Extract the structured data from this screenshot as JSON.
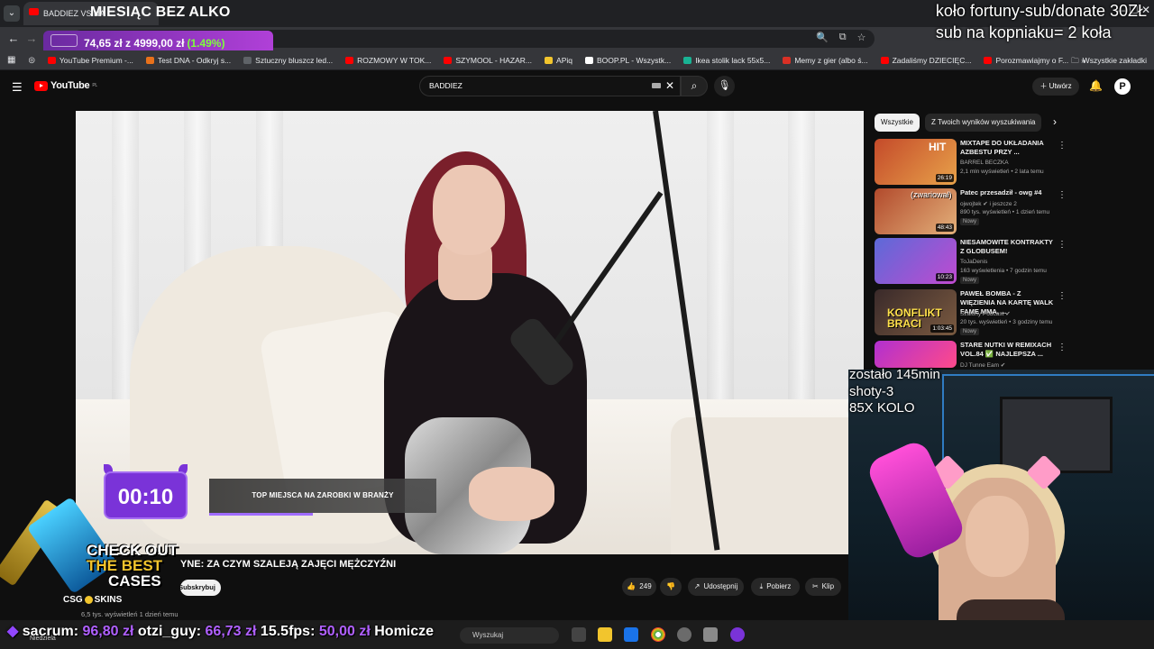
{
  "browser": {
    "tab_title": "BADDIEZ VS NA",
    "tab_title_suffix": "...",
    "dropdown_glyph": "⌄",
    "window_controls": "—   ☐   ✕",
    "toolbar_icons": [
      "🔍",
      "⧉",
      "☆",
      "⋮"
    ]
  },
  "stream_overlay": {
    "title": "MIESIĄC BEZ ALKO",
    "donation_current": "74,65 zł",
    "donation_sep": "z",
    "donation_goal": "4999,00 zł",
    "donation_pct": "(1.49%)",
    "donation_progress": 0.0149,
    "top_right_line1": "koło fortuny-sub/donate 30ZŁ",
    "top_right_line2": "sub na kopniaku= 2 koła",
    "cam_line1": "zostało 145min",
    "cam_line2": "shoty-3",
    "cam_line3": "85X KOLO",
    "timer": "00:10",
    "ticker_segments": [
      {
        "name": "sacrum:",
        "amount": "96,80 zł"
      },
      {
        "name": "otzi_guy:",
        "amount": "66,73 zł"
      },
      {
        "name": "15.5fps:",
        "amount": "50,00 zł"
      },
      {
        "name": "Homicze",
        "amount": ""
      }
    ]
  },
  "bookmarks": {
    "items": [
      {
        "label": "YouTube Premium -...",
        "color": "#ff0000"
      },
      {
        "label": "Test DNA - Odkryj s...",
        "color": "#e8711b"
      },
      {
        "label": "Sztuczny bluszcz led...",
        "color": "#5f6368"
      },
      {
        "label": "ROZMOWY W TOK...",
        "color": "#ff0000"
      },
      {
        "label": "SZYMOOL - HAZAR...",
        "color": "#ff0000"
      },
      {
        "label": "APiq",
        "color": "#f2c52d"
      },
      {
        "label": "BOOP.PL - Wszystk...",
        "color": "#ffffff"
      },
      {
        "label": "Ikea stolik lack 55x5...",
        "color": "#19b394"
      },
      {
        "label": "Memy z gier (albo ś...",
        "color": "#d93025"
      },
      {
        "label": "Zadaliśmy DZIECIĘC...",
        "color": "#ff0000"
      },
      {
        "label": "Porozmawiajmy o F...",
        "color": "#ff0000"
      }
    ],
    "overflow": "»",
    "all_label": "Wszystkie zakładki"
  },
  "youtube": {
    "logo": "YouTube",
    "logo_region": "PL",
    "search_value": "BADDIEZ",
    "create_label": "Utwórz",
    "avatar_letter": "P",
    "video_lower_third": "TOP MIEJSCA NA ZAROBKI W BRANŻY",
    "video_title": "YNE: ZA CZYM SZALEJĄ ZAJĘCI MĘŻCZYŹNI",
    "subscribe_label": "Subskrybuj",
    "likes": "249",
    "share_label": "Udostępnij",
    "download_label": "Pobierz",
    "clip_label": "Klip",
    "views_line": "6,5 tys. wyświetleń  1 dzień temu"
  },
  "sidebar": {
    "chips": [
      "Wszystkie",
      "Z Twoich wyników wyszukiwania"
    ],
    "recommendations": [
      {
        "title": "MIXTAPE DO UKŁADANIA AZBESTU PRZY ...",
        "channel": "BARREL BECZKA",
        "meta": "2,1 mln wyświetleń • 2 lata temu",
        "duration": "26:19",
        "new": "",
        "thumb": "#c44a2a"
      },
      {
        "title": "Patec przesadził - owg #4",
        "channel": "ojwojtek ✔ i jeszcze 2",
        "meta": "890 tys. wyświetleń • 1 dzień temu",
        "duration": "48:43",
        "new": "Nowy",
        "thumb": "#b24a2c"
      },
      {
        "title": "NIESAMOWITE KONTRAKTY Z GLOBUSEM!",
        "channel": "ToJaDenis",
        "meta": "163 wyświetlenia • 7 godzin temu",
        "duration": "10:23",
        "new": "Nowy",
        "thumb": "#6a3aa0"
      },
      {
        "title": "PAWEŁ BOMBA - Z WIĘZIENIA NA KARTĘ WALK FAME MMA. ...",
        "channel": "Szalony Podcast ✔",
        "meta": "20 tys. wyświetleń • 3 godziny temu",
        "duration": "1:03:45",
        "new": "Nowy",
        "thumb": "#3a2a2a"
      },
      {
        "title": "STARE NUTKI W REMIXACH VOL.84 ✅ NAJLEPSZA ...",
        "channel": "DJ Tunne Eam ✔",
        "meta": "",
        "duration": "",
        "new": "",
        "thumb": "#b030d0"
      }
    ],
    "thumb_overlays": [
      "HIT",
      "(zwariował)",
      "",
      "KONFLIKT BRACI",
      ""
    ]
  },
  "ad": {
    "line1": "CHECK OUT",
    "line2": "THE BEST",
    "line3": "CASES",
    "brand": "CSG",
    "brand2": "SKINS"
  },
  "taskbar": {
    "search_placeholder": "Wyszukaj",
    "day": "Niedziela"
  }
}
